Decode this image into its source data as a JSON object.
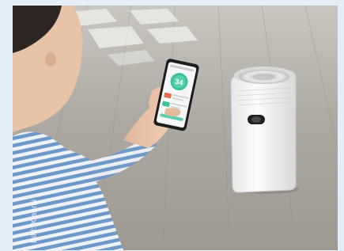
{
  "photo": {
    "scene": "person-holding-smartphone-with-air-purifier-app-near-air-purifier",
    "credit": "Bild: Xiaomi",
    "phone_screen": {
      "app_icon": "air-purifier-gauge-icon",
      "reading": "34"
    },
    "colors": {
      "frame_background": "#e4eef8",
      "floor": "#a9a59e",
      "app_accent": "#3cc29a",
      "purifier_body": "#f3f3f1",
      "shirt_stripe": "#6e98c7"
    }
  }
}
